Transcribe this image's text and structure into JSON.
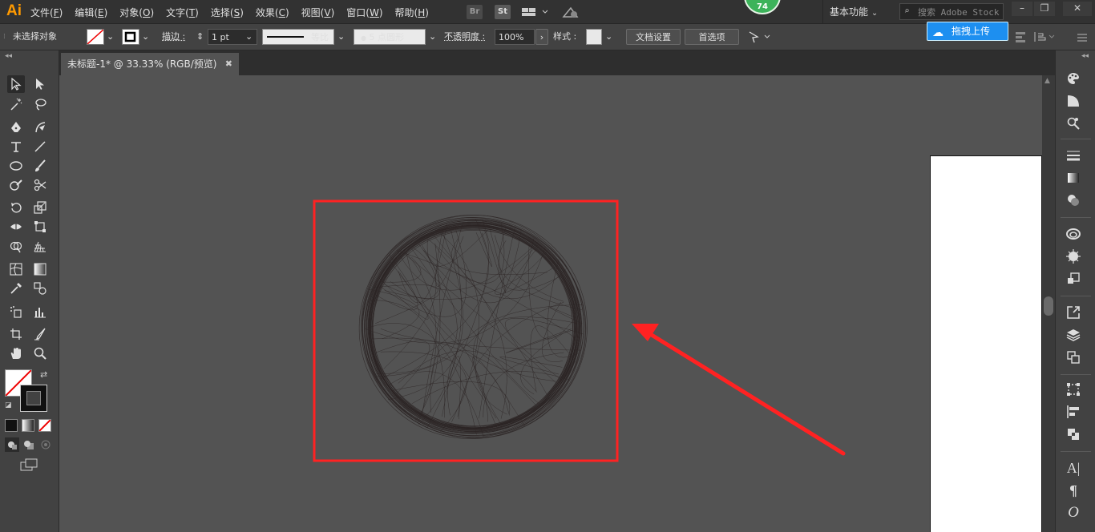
{
  "app": {
    "logo": "Ai",
    "menus": [
      {
        "label": "文件",
        "key": "F"
      },
      {
        "label": "编辑",
        "key": "E"
      },
      {
        "label": "对象",
        "key": "O"
      },
      {
        "label": "文字",
        "key": "T"
      },
      {
        "label": "选择",
        "key": "S"
      },
      {
        "label": "效果",
        "key": "C"
      },
      {
        "label": "视图",
        "key": "V"
      },
      {
        "label": "窗口",
        "key": "W"
      },
      {
        "label": "帮助",
        "key": "H"
      }
    ],
    "bridge_label": "Br",
    "stock_label": "St",
    "badge_count": "74",
    "workspace": "基本功能",
    "stock_search_placeholder": "搜索 Adobe Stock"
  },
  "controlbar": {
    "selection_label": "未选择对象",
    "stroke_label": "描边",
    "stroke_weight": "1 pt",
    "profile_label": "等比",
    "brush_label": "5 点圆形",
    "opacity_label": "不透明度",
    "opacity_value": "100%",
    "style_label": "样式",
    "doc_setup": "文档设置",
    "preferences": "首选项"
  },
  "upload": {
    "label": "拖拽上传"
  },
  "document": {
    "tab_title": "未标题-1* @ 33.33% (RGB/预览)"
  },
  "colors": {
    "accent_ai": "#ff9a00",
    "highlight_red": "#ff2222",
    "badge_green": "#3cb35a",
    "upload_blue": "#1d8ff0",
    "scribble_stroke": "#2c2424"
  },
  "icons": {
    "left_tools": [
      "selection-tool-icon",
      "direct-selection-tool-icon",
      "magic-wand-tool-icon",
      "lasso-tool-icon",
      "pen-tool-icon",
      "curvature-tool-icon",
      "type-tool-icon",
      "line-segment-tool-icon",
      "ellipse-tool-icon",
      "paintbrush-tool-icon",
      "shaper-tool-icon",
      "scissors-tool-icon",
      "rotate-tool-icon",
      "scale-tool-icon",
      "width-tool-icon",
      "free-transform-tool-icon",
      "shape-builder-tool-icon",
      "perspective-grid-tool-icon",
      "mesh-tool-icon",
      "gradient-tool-icon",
      "eyedropper-tool-icon",
      "blend-tool-icon",
      "symbol-sprayer-tool-icon",
      "column-graph-tool-icon",
      "artboard-tool-icon",
      "slice-tool-icon",
      "hand-tool-icon",
      "zoom-tool-icon"
    ],
    "right_dock": [
      "color-panel-icon",
      "color-guide-icon",
      "appearance-icon",
      "stroke-icon",
      "gradient-icon",
      "transparency-icon",
      "libraries-icon",
      "symbols-icon",
      "asset-export-icon",
      "artboards-icon",
      "layers-icon",
      "links-icon",
      "transform-icon",
      "align-icon",
      "pathfinder-icon",
      "character-icon",
      "paragraph-icon",
      "opentype-icon"
    ]
  }
}
